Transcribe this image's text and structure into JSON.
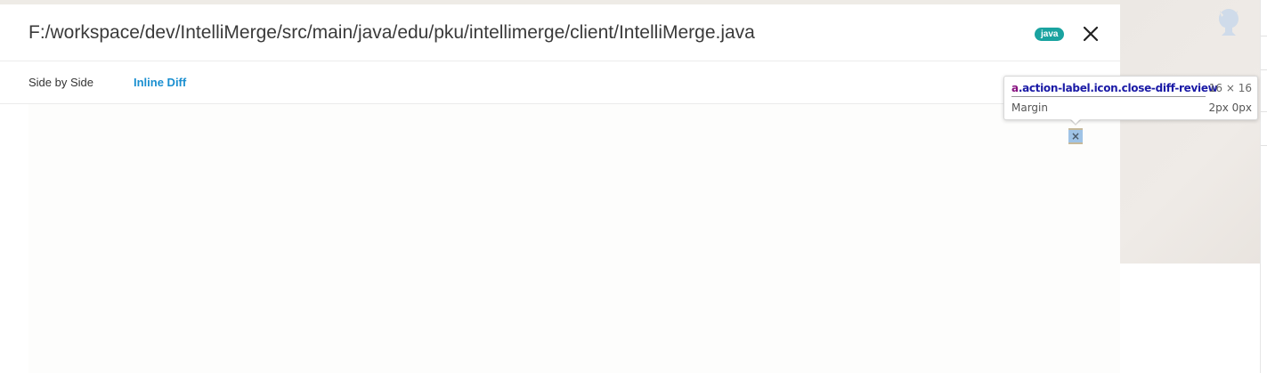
{
  "modal": {
    "file_path": "F:/workspace/dev/IntelliMerge/src/main/java/edu/pku/intellimerge/client/IntelliMerge.java",
    "language_badge": "java",
    "close_icon": "close-icon"
  },
  "tabs": [
    {
      "label": "Side by Side",
      "active": false
    },
    {
      "label": "Inline Diff",
      "active": true
    }
  ],
  "inspector_tooltip": {
    "tag": "a",
    "classes": ".action-label.icon.close-diff-review",
    "size": "16 × 16",
    "margin_label": "Margin",
    "margin_value": "2px 0px"
  },
  "highlighted_element": {
    "icon": "close-icon",
    "glyph": "×"
  },
  "colors": {
    "badge": "#1aa3a0",
    "active_tab": "#1a8fd0",
    "highlight_content": "#9fc3e6",
    "highlight_margin": "#c6b99a"
  }
}
